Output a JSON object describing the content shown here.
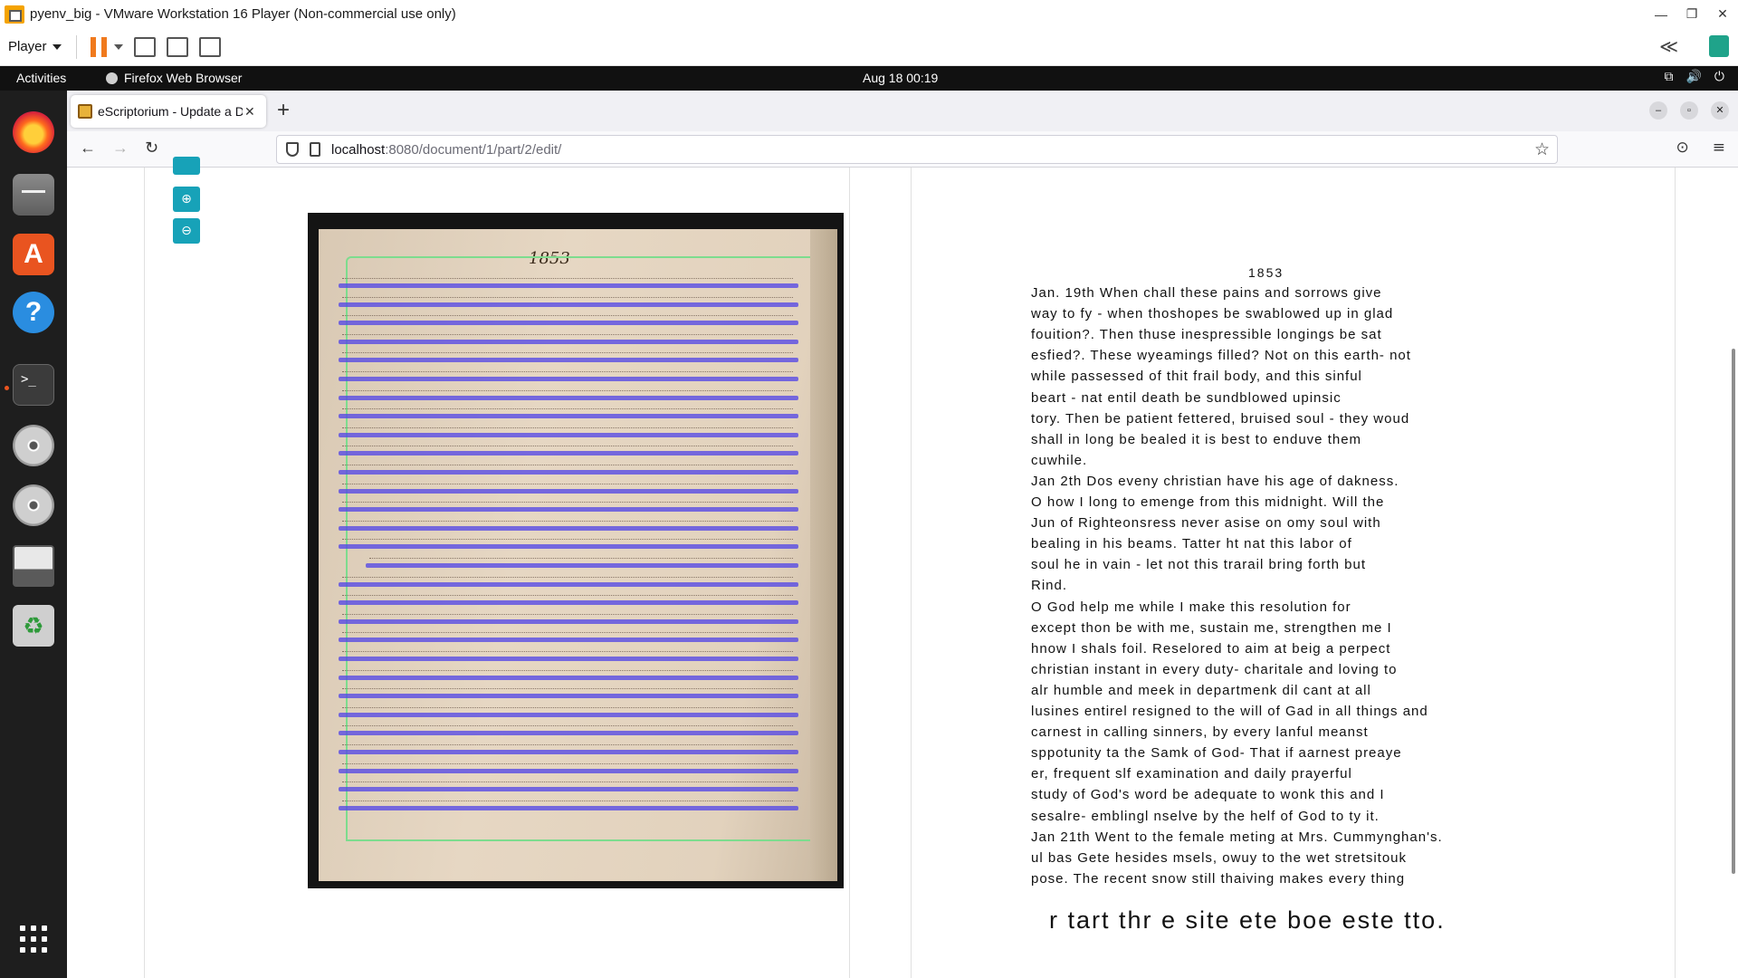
{
  "vm": {
    "title": "pyenv_big - VMware Workstation 16 Player (Non-commercial use only)",
    "menu_label": "Player",
    "controls": {
      "minimize": "—",
      "restore": "❐",
      "close": "✕"
    },
    "collapse_glyph": "≪"
  },
  "gnome": {
    "activities": "Activities",
    "app_name": "Firefox Web Browser",
    "clock": "Aug 18  00:19",
    "tray": {
      "network": "⧉",
      "volume": "🔊",
      "power": "⏻"
    }
  },
  "dock": {
    "terminal_prompt": ">_",
    "help_glyph": "?",
    "software_glyph": "A",
    "trash_glyph": "♻"
  },
  "browser": {
    "tab_title": "eScriptorium - Update a Do",
    "tab_close": "✕",
    "new_tab": "+",
    "window_controls": {
      "minimize": "–",
      "restore": "▫",
      "close": "✕"
    },
    "nav": {
      "back": "←",
      "forward": "→",
      "reload": "↻"
    },
    "url_host": "localhost",
    "url_rest": ":8080/document/1/part/2/edit/",
    "star": "☆",
    "pocket": "⊙",
    "menu": "≡"
  },
  "editor": {
    "zoom_in": "⊕",
    "zoom_out": "⊖",
    "manuscript_year": "1853",
    "transcription_heading": "1853",
    "transcription_lines": [
      "Jan. 19th When chall these pains and sorrows give",
      "way to fy - when thoshopes be swablowed up in glad",
      "fouition?. Then thuse inespressible longings be sat",
      "esfied?. These wyeamings filled? Not on this earth- not",
      "while passessed of thit frail body, and this sinful",
      "beart - nat entil death be sundblowed upinsic",
      "tory. Then be patient fettered, bruised soul - they woud",
      "shall in long be bealed it is best to enduve them",
      "cuwhile.",
      "Jan 2th Dos eveny christian have his age of dakness.",
      "O how I long to emenge from this midnight. Will the",
      "Jun of Righteonsress never asise on omy soul with",
      "bealing in his beams. Tatter ht nat this labor of",
      "soul he in vain - let not this trarail bring forth but",
      "Rind.",
      "     O God help me while I make this resolution for",
      "except thon be with me, sustain me, strengthen me I",
      " hnow I shals foil. Reselored to aim at beig a perpect",
      "christian instant in every duty- charitale and loving to",
      "alr humble and meek in departmenk dil cant at all",
      "lusines entirel resigned to the will of Gad in all things and",
      "carnest in calling sinners, by every lanful meanst",
      "sppotunity ta the Samk of God- That if aarnest preaye",
      "er, frequent slf examination and daily prayerful",
      "study of God's word be adequate to wonk this and I",
      "sesalre- emblingl nselve by the helf of God to ty it.",
      "Jan 21th Went to the female meting at Mrs. Cummynghan's.",
      "ul bas Gete hesides msels, owuy to the wet stretsitouk",
      "pose. The recent snow still thaiving makes every thing"
    ],
    "transcription_last": "r tart thr e site ete boe este tto."
  }
}
